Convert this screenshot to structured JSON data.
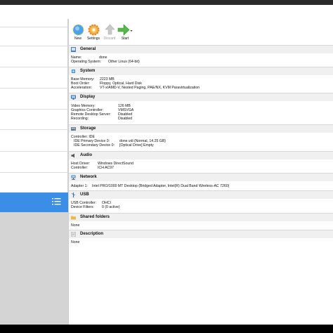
{
  "toolbar": {
    "buttons": [
      {
        "label": "New",
        "icon": "new-icon",
        "enabled": true
      },
      {
        "label": "Settings",
        "icon": "gear-icon",
        "enabled": true
      },
      {
        "label": "Discard",
        "icon": "discard-arrow-icon",
        "enabled": false
      },
      {
        "label": "Start",
        "icon": "start-arrow-icon",
        "enabled": true
      }
    ]
  },
  "sections": {
    "general": {
      "title": "General",
      "rows": [
        {
          "label": "Name:",
          "value": "done"
        },
        {
          "label": "Operating System:",
          "value": "Other Linux (64-bit)"
        }
      ]
    },
    "system": {
      "title": "System",
      "rows": [
        {
          "label": "Base Memory:",
          "value": "2223 MB"
        },
        {
          "label": "Boot Order:",
          "value": "Floppy, Optical, Hard Disk"
        },
        {
          "label": "Acceleration:",
          "value": "VT-x/AMD-V, Nested Paging, PAE/NX, KVM Paravirtualization"
        }
      ]
    },
    "display": {
      "title": "Display",
      "rows": [
        {
          "label": "Video Memory:",
          "value": "126 MB"
        },
        {
          "label": "Graphics Controller:",
          "value": "VMSVGA"
        },
        {
          "label": "Remote Desktop Server:",
          "value": "Disabled"
        },
        {
          "label": "Recording:",
          "value": "Disabled"
        }
      ]
    },
    "storage": {
      "title": "Storage",
      "rows": [
        {
          "label": "Controller: IDE",
          "value": ""
        },
        {
          "label": "IDE Primary Device 0:",
          "value": "done.vdi (Normal, 14.25 GB)"
        },
        {
          "label": "IDE Secondary Device 0:",
          "value": "[Optical Drive] Empty"
        }
      ]
    },
    "audio": {
      "title": "Audio",
      "rows": [
        {
          "label": "Host Driver:",
          "value": "Windows DirectSound"
        },
        {
          "label": "Controller:",
          "value": "ICH AC97"
        }
      ]
    },
    "network": {
      "title": "Network",
      "rows": [
        {
          "label": "Adapter 1:",
          "value": "Intel PRO/1000 MT Desktop (Bridged Adapter, Intel(R) Dual Band Wireless-AC 7260)"
        }
      ]
    },
    "usb": {
      "title": "USB",
      "rows": [
        {
          "label": "USB Controller:",
          "value": "OHCI"
        },
        {
          "label": "Device Filters:",
          "value": "0 (0 active)"
        }
      ]
    },
    "shared": {
      "title": "Shared folders",
      "rows": [
        {
          "label": "None",
          "value": ""
        }
      ]
    },
    "description": {
      "title": "Description",
      "rows": [
        {
          "label": "None",
          "value": ""
        }
      ]
    }
  },
  "colors": {
    "selection": "#3a8ee6",
    "section_bg": "#f0f0f0",
    "left_gray": "#d4d4d4"
  }
}
